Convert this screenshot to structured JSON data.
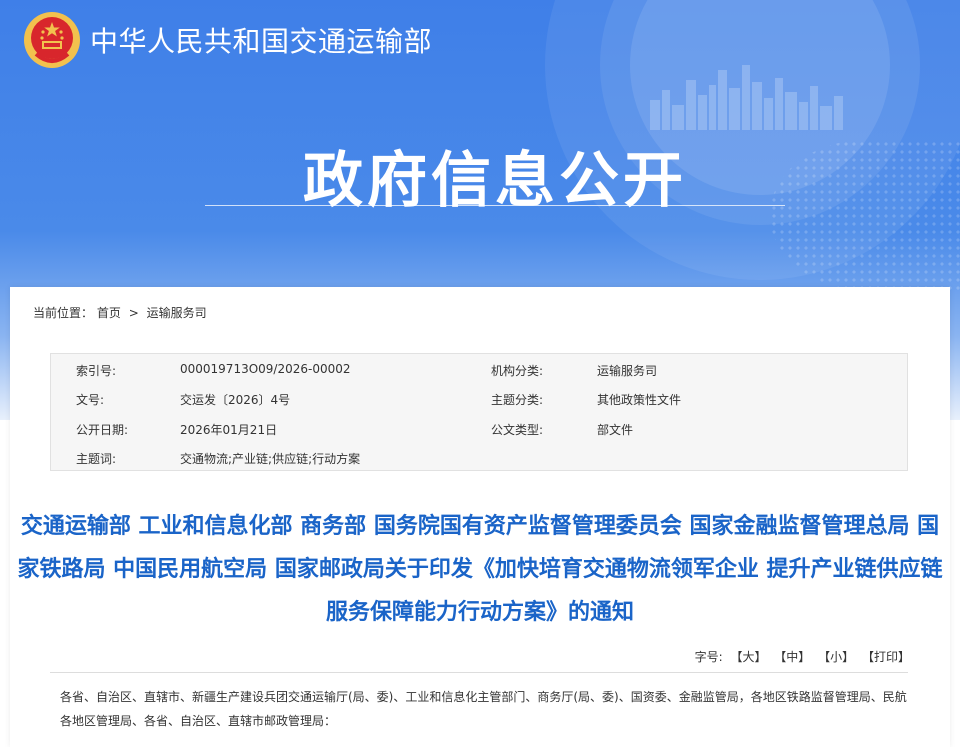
{
  "header": {
    "ministry_name": "中华人民共和国交通运输部",
    "section_title": "政府信息公开"
  },
  "breadcrumb": {
    "label": "当前位置：",
    "home": "首页",
    "separator": ">",
    "current": "运输服务司"
  },
  "meta": {
    "index_no_label": "索引号:",
    "index_no": "000019713O09/2026-00002",
    "doc_no_label": "文号:",
    "doc_no": "交运发〔2026〕4号",
    "date_label": "公开日期:",
    "date": "2026年01月21日",
    "keywords_label": "主题词:",
    "keywords": "交通物流;产业链;供应链;行动方案",
    "org_label": "机构分类:",
    "org": "运输服务司",
    "topic_label": "主题分类:",
    "topic": "其他政策性文件",
    "type_label": "公文类型:",
    "type": "部文件"
  },
  "document": {
    "title": "交通运输部 工业和信息化部 商务部 国务院国有资产监督管理委员会 国家金融监督管理总局 国家铁路局 中国民用航空局 国家邮政局关于印发《加快培育交通物流领军企业 提升产业链供应链服务保障能力行动方案》的通知",
    "body": "各省、自治区、直辖市、新疆生产建设兵团交通运输厅(局、委)、工业和信息化主管部门、商务厅(局、委)、国资委、金融监管局，各地区铁路监督管理局、民航各地区管理局、各省、自治区、直辖市邮政管理局："
  },
  "toolbar": {
    "font_label": "字号:",
    "large": "【大】",
    "medium": "【中】",
    "small": "【小】",
    "print": "【打印】"
  },
  "colors": {
    "banner_blue": "#3f7fe8",
    "title_blue": "#1a64c8"
  }
}
